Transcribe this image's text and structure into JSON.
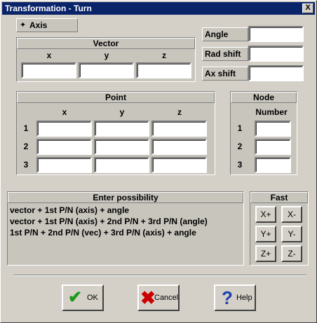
{
  "window": {
    "title": "Transformation - Turn",
    "close_label": "X"
  },
  "axis": {
    "label": "Axis"
  },
  "vector": {
    "title": "Vector",
    "cols": [
      "x",
      "y",
      "z"
    ]
  },
  "params": {
    "angle_label": "Angle",
    "rad_shift_label": "Rad shift",
    "ax_shift_label": "Ax shift"
  },
  "point": {
    "title": "Point",
    "cols": [
      "x",
      "y",
      "z"
    ],
    "rows": [
      "1",
      "2",
      "3"
    ]
  },
  "node": {
    "title": "Node",
    "subtitle": "Number",
    "rows": [
      "1",
      "2",
      "3"
    ]
  },
  "possibility": {
    "title": "Enter possibility",
    "lines": [
      "vector + 1st P/N (axis) + angle",
      "vector + 1st P/N (axis) + 2nd P/N + 3rd P/N (angle)",
      "1st P/N + 2nd P/N (vec) + 3rd P/N (axis) + angle"
    ]
  },
  "fast": {
    "title": "Fast",
    "buttons": [
      "X+",
      "X-",
      "Y+",
      "Y-",
      "Z+",
      "Z-"
    ]
  },
  "actions": {
    "ok": "OK",
    "cancel": "Cancel",
    "help": "Help"
  }
}
